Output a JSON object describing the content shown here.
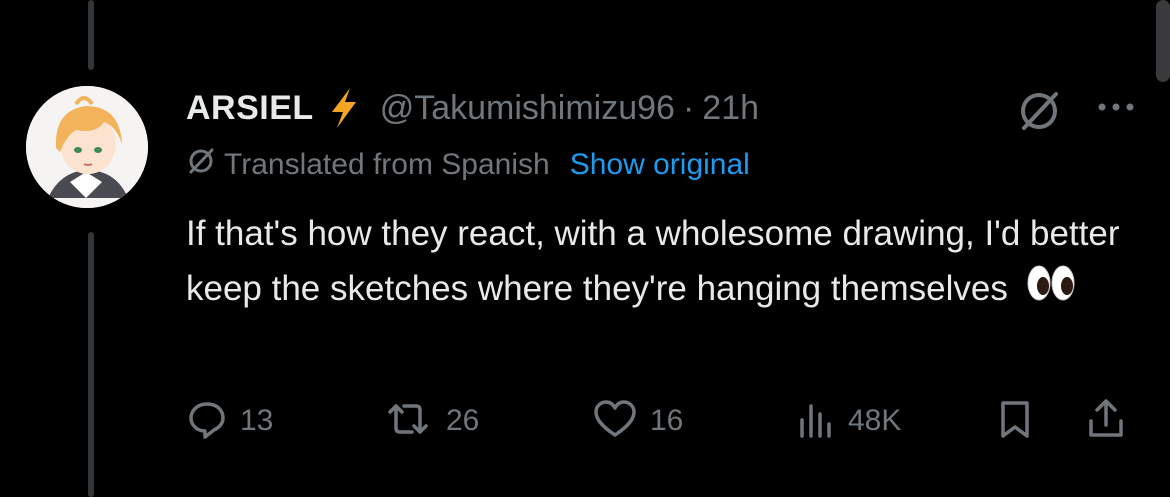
{
  "tweet": {
    "display_name": "ARSIEL",
    "handle": "@Takumishimizu96",
    "separator": "·",
    "time": "21h",
    "translated_label": "Translated from Spanish",
    "show_original": "Show original",
    "text": "If that's how they react, with a wholesome drawing, I'd better keep the sketches where they're hanging themselves",
    "emoji": "eyes-emoji"
  },
  "actions": {
    "replies": "13",
    "reposts": "26",
    "likes": "16",
    "views": "48K"
  },
  "colors": {
    "background": "#000000",
    "primary_text": "#e7e9ea",
    "secondary_text": "#71767b",
    "link": "#1d9bf0",
    "bolt": "#f4a524"
  },
  "icons": {
    "verified_badge": "lightning-bolt-icon",
    "grok": "grok-icon",
    "more": "more-horizontal-icon",
    "reply": "reply-icon",
    "repost": "repost-icon",
    "like": "heart-icon",
    "views": "views-chart-icon",
    "bookmark": "bookmark-icon",
    "share": "share-icon"
  }
}
